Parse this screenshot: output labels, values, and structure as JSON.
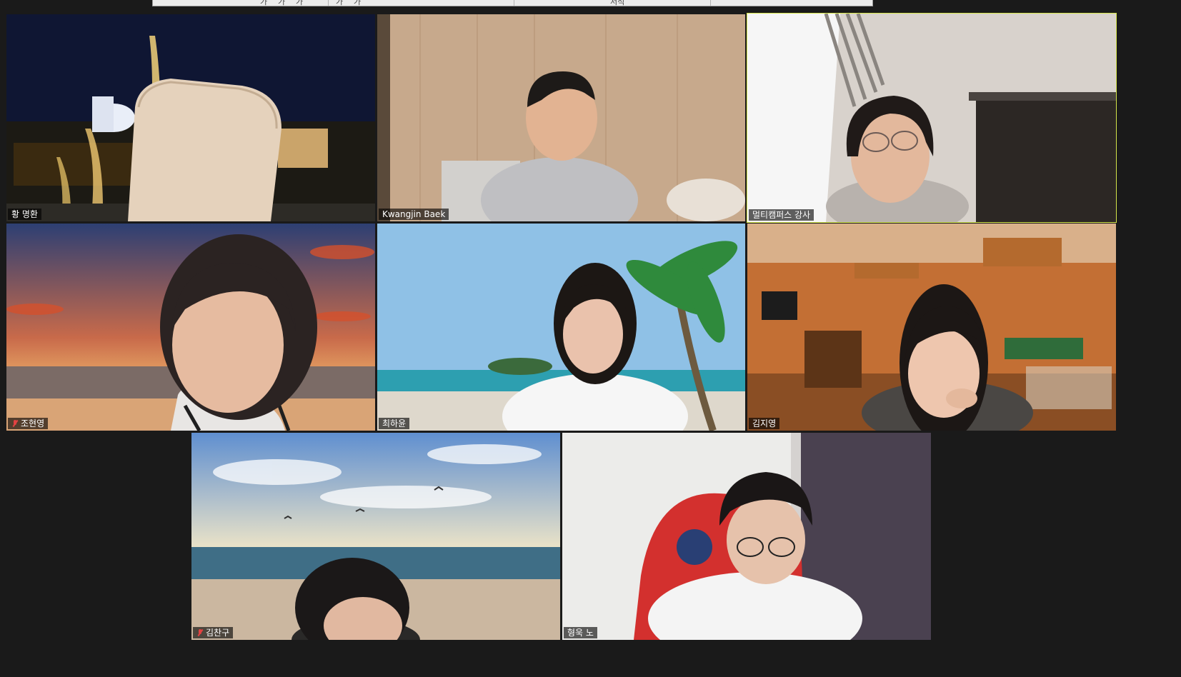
{
  "toolbar": {
    "items": [
      "가",
      "가",
      "가",
      "가",
      "가",
      "서식"
    ]
  },
  "participants": [
    {
      "name": "황 명환",
      "muted": false,
      "active": false,
      "scene": "night-fountain-chair"
    },
    {
      "name": "Kwangjin Baek",
      "muted": false,
      "active": false,
      "scene": "wood-room"
    },
    {
      "name": "멀티캠퍼스 강사",
      "muted": false,
      "active": true,
      "scene": "bright-room"
    },
    {
      "name": "조현영",
      "muted": true,
      "active": false,
      "scene": "sunset-sea"
    },
    {
      "name": "최하윤",
      "muted": false,
      "active": false,
      "scene": "tropical-beach"
    },
    {
      "name": "김지영",
      "muted": false,
      "active": false,
      "scene": "billiard-room"
    },
    {
      "name": "김찬구",
      "muted": true,
      "active": false,
      "scene": "sunrise-beach"
    },
    {
      "name": "형욱 노",
      "muted": false,
      "active": false,
      "scene": "gaming-room"
    }
  ],
  "colors": {
    "active_speaker_border": "#d6e64a",
    "mute_red": "#e34242",
    "background": "#1a1a1a"
  }
}
